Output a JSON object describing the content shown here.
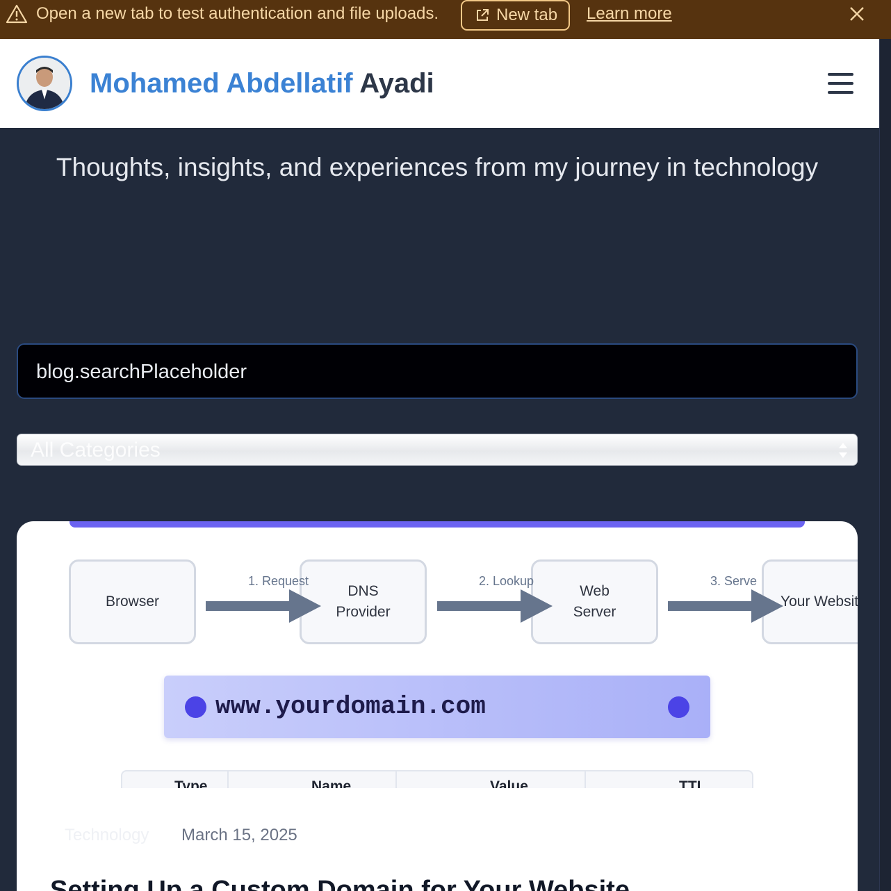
{
  "banner": {
    "message": "Open a new tab to test authentication and file uploads.",
    "new_tab_label": "New tab",
    "learn_more_label": "Learn more",
    "icons": [
      "warning-icon",
      "external-link-icon",
      "close-icon"
    ]
  },
  "header": {
    "name_first": "Mohamed Abdellatif",
    "name_last": "Ayadi",
    "icons": [
      "avatar",
      "hamburger-menu-icon"
    ]
  },
  "hero": {
    "tagline": "Thoughts, insights, and experiences from my journey in technology"
  },
  "filters": {
    "search_value": "blog.searchPlaceholder",
    "category_selected": "All Categories"
  },
  "post": {
    "diagram": {
      "nodes": [
        "Browser",
        "DNS\nProvider",
        "Web\nServer",
        "Your Website"
      ],
      "steps": [
        "1. Request",
        "2. Lookup",
        "3. Serve"
      ],
      "domain": "www.yourdomain.com",
      "table_headers": [
        "Type",
        "Name",
        "Value",
        "TTL"
      ]
    },
    "category": "Technology",
    "date": "March 15, 2025",
    "title": "Setting Up a Custom Domain for Your Website"
  },
  "colors": {
    "banner_bg": "#56330f",
    "page_bg": "#212a3b",
    "brand_blue": "#3b82d4",
    "accent_purple": "#4b43e6"
  }
}
